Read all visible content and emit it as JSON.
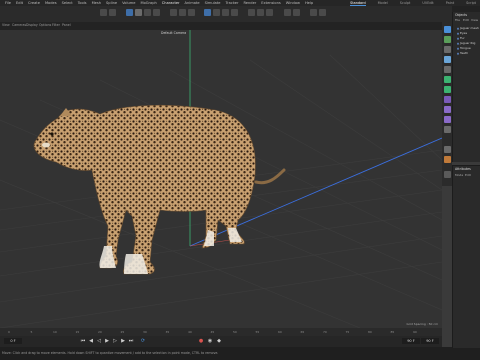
{
  "menu": [
    "File",
    "Edit",
    "Create",
    "Modes",
    "Select",
    "Tools",
    "Mesh",
    "Spline",
    "Volume",
    "MoGraph",
    "Character",
    "Animate",
    "Simulate",
    "Tracker",
    "Render",
    "Extensions",
    "Window",
    "Help"
  ],
  "layouts": [
    "Standard",
    "Model",
    "Sculpt",
    "UVEdit",
    "Paint",
    "Script"
  ],
  "viewport": {
    "menu": [
      "View",
      "Cameras",
      "Display",
      "Options",
      "Filter",
      "Panel"
    ],
    "camera_label": "Default Camera",
    "grid_info": "Grid Spacing : 50 cm"
  },
  "timeline": {
    "frames": [
      "0",
      "5",
      "10",
      "15",
      "20",
      "25",
      "30",
      "35",
      "40",
      "45",
      "50",
      "55",
      "60",
      "65",
      "70",
      "75",
      "80",
      "85",
      "90"
    ],
    "current_frame": "0 F",
    "end_frame": "90 F",
    "end_frame2": "90 F"
  },
  "status_text": "Move: Click and drag to move elements. Hold down SHIFT to quantize movement / add to the selection in point mode, CTRL to remove.",
  "object_panel": {
    "title": "Objects",
    "menu": [
      "File",
      "Edit",
      "View"
    ],
    "items": [
      "Jaguar mesh",
      "Eyes",
      "Fur",
      "Jaguar Rig",
      "Tongue",
      "Teeth"
    ]
  },
  "attribute_panel": {
    "title": "Attributes",
    "menu": [
      "Mode",
      "Edit"
    ]
  },
  "colors": {
    "accent": "#4a90d9",
    "axis_green": "#3cb371",
    "axis_blue": "#3b6fe0",
    "axis_red": "#c0504d",
    "jaguar_coat": "#c8a070"
  }
}
